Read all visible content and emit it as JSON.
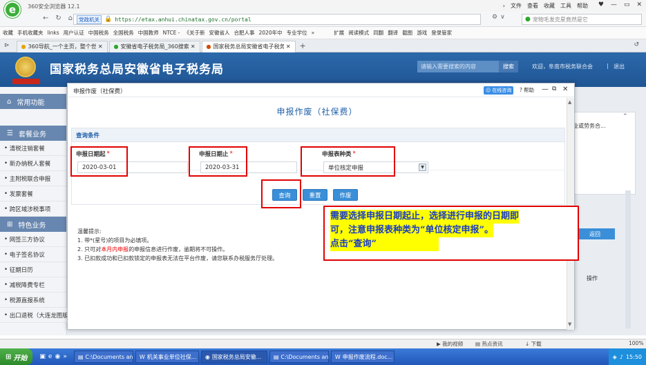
{
  "browser": {
    "name": "360安全浏览器 12.1",
    "menu": [
      "文件",
      "查看",
      "收藏",
      "工具",
      "帮助"
    ],
    "site_badge": "党政机关",
    "url": "https://etax.anhui.chinatax.gov.cn/portal",
    "search_placeholder": "宠物毛发克星竟然是它",
    "bookmarks": [
      "收藏",
      "手机收藏夹",
      "links",
      "用户认证",
      "中国税务",
      "全国税务",
      "中国教师",
      "NTCE -",
      "《关于新",
      "安徽省人",
      "合肥人事",
      "2020年中",
      "专业学位",
      "扩展",
      "阅读模式",
      "同翻",
      "翻译",
      "截图",
      "游戏",
      "登录管家"
    ],
    "tabs": [
      {
        "label": "360导航_一个主页，整个世界",
        "active": false
      },
      {
        "label": "安徽省电子税务局_360搜索",
        "active": false
      },
      {
        "label": "国家税务总局安徽省电子税务局",
        "active": true
      }
    ],
    "new_tab": "+"
  },
  "site": {
    "title": "国家税务总局安徽省电子税务局",
    "search_placeholder": "请输入需要搜索的内容",
    "search_button": "搜索",
    "welcome": "欢迎，阜南市税务联合会",
    "logout": "退出"
  },
  "sidebar": {
    "common_header": "常用功能",
    "package_header": "套餐业务",
    "package_items": [
      "清税注销套餐",
      "新办纳税人套餐",
      "主附税联合申报",
      "发票套餐",
      "跨区域涉税事项"
    ],
    "special_header": "特色业务",
    "special_items": [
      "网签三方协议",
      "电子签名协议",
      "征期日历",
      "减税降费专栏",
      "税源直报系统",
      "出口退税（大连龙图版）"
    ]
  },
  "background": {
    "right_text": "业或劳务合...",
    "return_button": "返回",
    "operation": "操作"
  },
  "modal": {
    "title": "申报作废（社保费）",
    "online_consult": "在线咨询",
    "help": "帮助",
    "heading": "申报作废（社保费）",
    "section_title": "查询条件",
    "field_start_label": "申报日期起",
    "field_start_value": "2020-03-01",
    "field_end_label": "申报日期止",
    "field_end_value": "2020-03-31",
    "field_type_label": "申报表种类",
    "field_type_value": "单位核定申报",
    "required_mark": "*",
    "btn_query": "查询",
    "btn_reset": "重置",
    "btn_void": "作废",
    "tips_title": "温馨提示:",
    "tip1": "1. 带*(星号)的项目为必填项。",
    "tip2_prefix": "2. 只可对",
    "tip2_highlight": "本月内申报",
    "tip2_suffix": "的申报信息进行作废，逾期将不可操作。",
    "tip3": "3. 已扣款成功和已扣款锁定的申报表无法在平台作废，请您联系办税服务厅处理。"
  },
  "annotation": {
    "line1": "需要选择申报日期起止，选择进行申报的日期即",
    "line2": "可，注意申报表种类为“单位核定申报”。",
    "line3": "点击“查询”"
  },
  "statusbar": {
    "items": [
      "我的视频",
      "热点资讯",
      "下载",
      "100%"
    ]
  },
  "taskbar": {
    "start": "开始",
    "tasks": [
      "C:\\Documents and...",
      "机关事业单位社保...",
      "国家税务总局安徽...",
      "C:\\Documents and...",
      "申报作废流程.doc..."
    ],
    "time": "15:50"
  },
  "colors": {
    "accent": "#2c69ab",
    "annotation_red": "#e20000",
    "annotation_yellow": "#ffff00",
    "annotation_text": "#1a3cc4"
  }
}
